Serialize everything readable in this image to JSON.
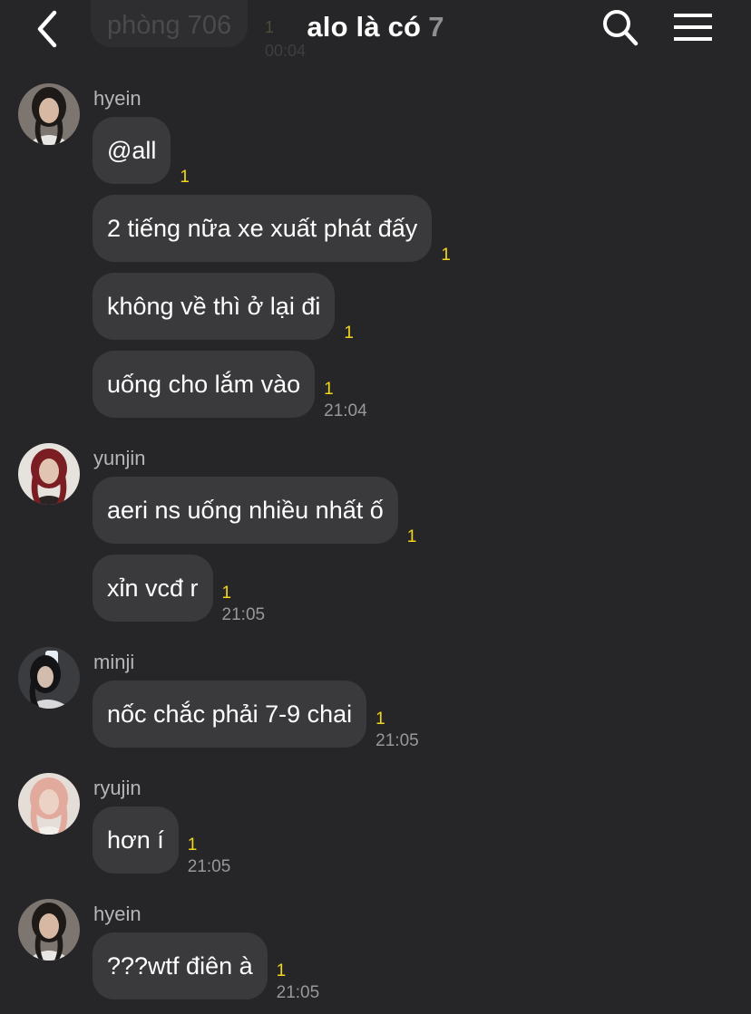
{
  "header": {
    "title": "alo là có",
    "member_count": "7",
    "ghost_message": "phòng 706",
    "ghost_unread": "1",
    "ghost_time": "00:04"
  },
  "colors": {
    "background": "#262628",
    "bubble": "#3a3a3c",
    "unread": "#f3d51b",
    "timestamp": "#98989c"
  },
  "icons": {
    "back": "chevron-left-icon",
    "search": "search-icon",
    "menu": "hamburger-menu-icon"
  },
  "groups": [
    {
      "sender": "hyein",
      "messages": [
        {
          "text": "@all",
          "unread": "1",
          "time": ""
        },
        {
          "text": "2 tiếng nữa xe xuất phát đấy",
          "unread": "1",
          "time": ""
        },
        {
          "text": "không về thì ở lại đi",
          "unread": "1",
          "time": ""
        },
        {
          "text": "uống cho lắm vào",
          "unread": "1",
          "time": "21:04"
        }
      ]
    },
    {
      "sender": "yunjin",
      "messages": [
        {
          "text": "aeri ns uống nhiều nhất ố",
          "unread": "1",
          "time": ""
        },
        {
          "text": "xỉn vcđ r",
          "unread": "1",
          "time": "21:05"
        }
      ]
    },
    {
      "sender": "minji",
      "messages": [
        {
          "text": "nốc chắc phải 7-9 chai",
          "unread": "1",
          "time": "21:05"
        }
      ]
    },
    {
      "sender": "ryujin",
      "messages": [
        {
          "text": "hơn í",
          "unread": "1",
          "time": "21:05"
        }
      ]
    },
    {
      "sender": "hyein",
      "messages": [
        {
          "text": "???wtf điên à",
          "unread": "1",
          "time": "21:05"
        }
      ]
    }
  ]
}
